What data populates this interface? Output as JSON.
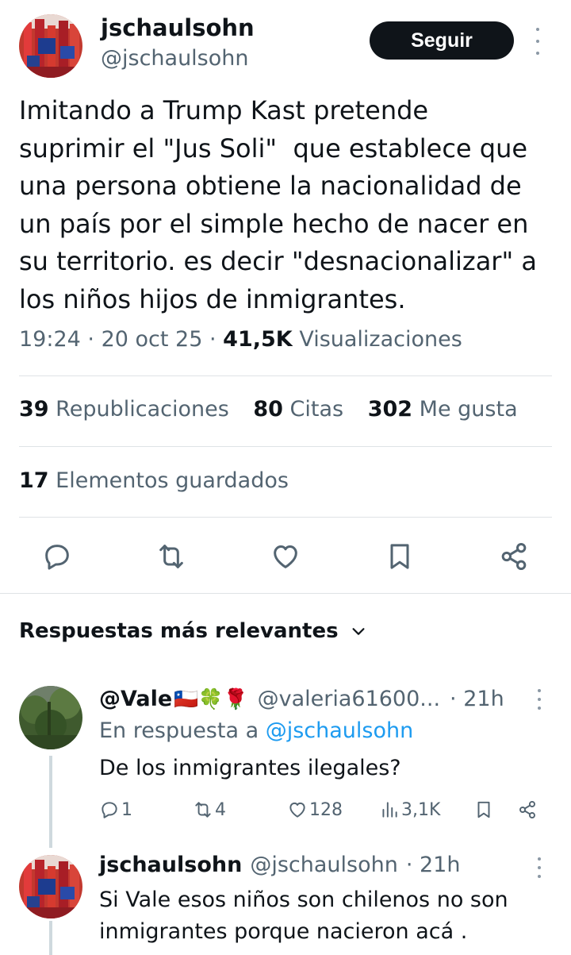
{
  "tweet": {
    "author_name": "jschaulsohn",
    "author_handle": "@jschaulsohn",
    "follow_label": "Seguir",
    "text": "Imitando a Trump Kast pretende\nsuprimir el \"Jus Soli\"  que establece que\nuna persona obtiene la nacionalidad de\nun país por el simple hecho de nacer en\nsu territorio. es decir \"desnacionalizar\" a\nlos niños hijos de inmigrantes.",
    "time": "19:24",
    "date": "20 oct 25",
    "views_count": "41,5K",
    "views_label": "Visualizaciones",
    "reposts_count": "39",
    "reposts_label": "Republicaciones",
    "quotes_count": "80",
    "quotes_label": "Citas",
    "likes_count": "302",
    "likes_label": "Me gusta",
    "bookmarks_count": "17",
    "bookmarks_label": "Elementos guardados"
  },
  "replies_header": "Respuestas más relevantes",
  "replies": [
    {
      "name": "@Vale",
      "emojis": "🇨🇱🍀🌹",
      "handle": "@valeria61600...",
      "time": "· 21h",
      "in_reply_prefix": "En respuesta a ",
      "in_reply_handle": "@jschaulsohn",
      "text": "De los inmigrantes ilegales?",
      "reply_count": "1",
      "repost_count": "4",
      "like_count": "128",
      "view_count": "3,1K"
    },
    {
      "name": "jschaulsohn",
      "handle": "@jschaulsohn",
      "time": "· 21h",
      "text": "Si Vale esos niños son chilenos no son\ninmigrantes porque nacieron acá ."
    }
  ],
  "colors": {
    "text": "#0f1419",
    "secondary": "#536471",
    "link": "#1d9bf0",
    "divider": "#dfe3e6",
    "button": "#0f1419"
  },
  "icons": [
    "more-icon",
    "reply-icon",
    "repost-icon",
    "like-icon",
    "bookmark-icon",
    "share-icon",
    "views-icon",
    "chevron-down-icon"
  ]
}
